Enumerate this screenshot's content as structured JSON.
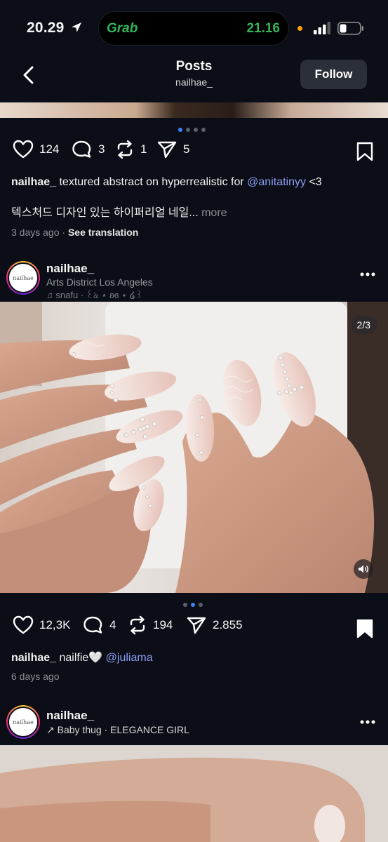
{
  "status": {
    "time": "20.29",
    "island_app": "Grab",
    "island_time": "21.16"
  },
  "header": {
    "title": "Posts",
    "subtitle": "nailhae_",
    "follow_label": "Follow"
  },
  "post1": {
    "likes": "124",
    "comments": "3",
    "reposts": "1",
    "shares": "5",
    "username": "nailhae_",
    "caption": " textured abstract on hyperrealistic for ",
    "mention": "@anitatinyy",
    "caption_end": " <3",
    "caption_line2": "텍스처드 디자인 있는 하이퍼리얼 네일...",
    "more": " more",
    "time": "3 days ago",
    "see_translation": "See translation"
  },
  "post2": {
    "username": "nailhae_",
    "location": "Arts District Los Angeles",
    "music": "snafu",
    "music_artist": "· ꒰ঌ ⋆ ʚɞ ⋆ ໒꒱",
    "page_badge": "2/3",
    "likes": "12,3K",
    "comments": "4",
    "reposts": "194",
    "shares": "2.855",
    "caption": " nailfie🤍 ",
    "mention": "@juliama",
    "time": "6 days ago"
  },
  "post3": {
    "username": "nailhae_",
    "music": "Baby thug · ELEGANCE GIRL"
  },
  "avatar_text": "nailhae",
  "colors": {
    "accent": "#3b82f6",
    "mention": "#8e9cf5",
    "background": "#0b0e16",
    "grab_green": "#33b45a"
  }
}
